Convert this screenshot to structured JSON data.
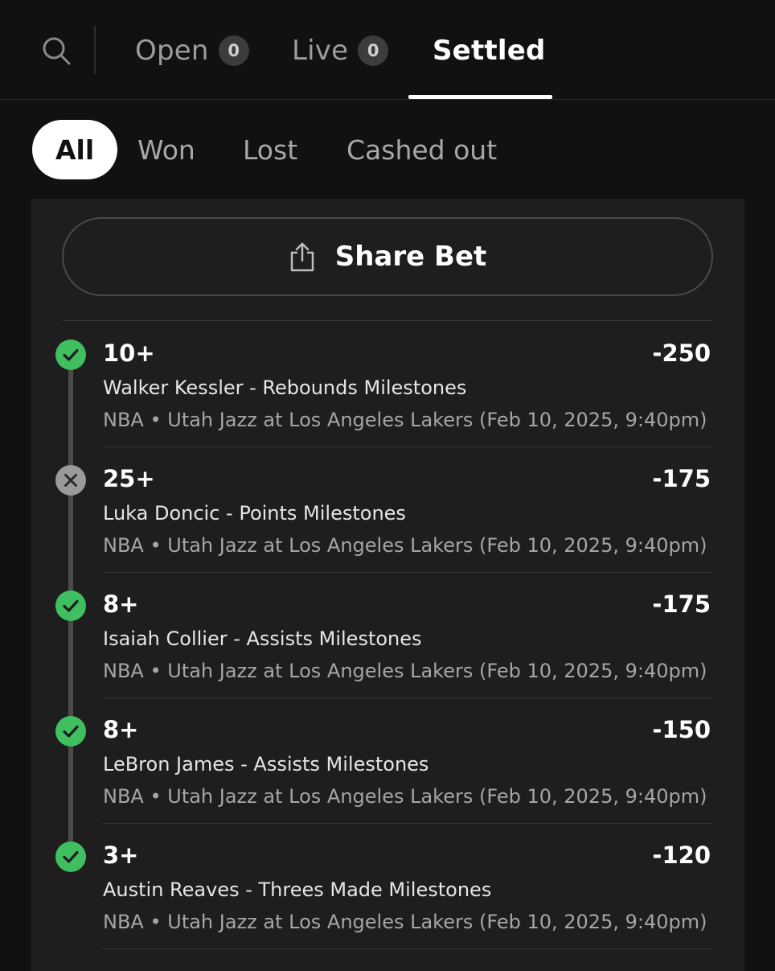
{
  "colors": {
    "background": "#111111",
    "card": "#1e1e1e",
    "won": "#3fbf5f",
    "lost": "#9a9a9a",
    "text_primary": "#ffffff",
    "text_secondary": "#a6a6a6"
  },
  "tabs": [
    {
      "label": "Open",
      "count": "0",
      "icon": "search-icon"
    },
    {
      "label": "Live",
      "count": "0"
    },
    {
      "label": "Settled",
      "active": true
    }
  ],
  "filters": [
    "All",
    "Won",
    "Lost",
    "Cashed out"
  ],
  "active_filter": "All",
  "share": {
    "label": "Share Bet",
    "icon": "share-icon"
  },
  "legs": [
    {
      "status": "won",
      "line": "10+",
      "odds": "-250",
      "market": "Walker Kessler - Rebounds Milestones",
      "event": "NBA • Utah Jazz at Los Angeles Lakers (Feb 10, 2025, 9:40pm)"
    },
    {
      "status": "lost",
      "line": "25+",
      "odds": "-175",
      "market": "Luka Doncic - Points Milestones",
      "event": "NBA • Utah Jazz at Los Angeles Lakers (Feb 10, 2025, 9:40pm)"
    },
    {
      "status": "won",
      "line": "8+",
      "odds": "-175",
      "market": "Isaiah Collier - Assists Milestones",
      "event": "NBA • Utah Jazz at Los Angeles Lakers (Feb 10, 2025, 9:40pm)"
    },
    {
      "status": "won",
      "line": "8+",
      "odds": "-150",
      "market": "LeBron James - Assists Milestones",
      "event": "NBA • Utah Jazz at Los Angeles Lakers (Feb 10, 2025, 9:40pm)"
    },
    {
      "status": "won",
      "line": "3+",
      "odds": "-120",
      "market": "Austin Reaves - Threes Made Milestones",
      "event": "NBA • Utah Jazz at Los Angeles Lakers (Feb 10, 2025, 9:40pm)"
    }
  ]
}
